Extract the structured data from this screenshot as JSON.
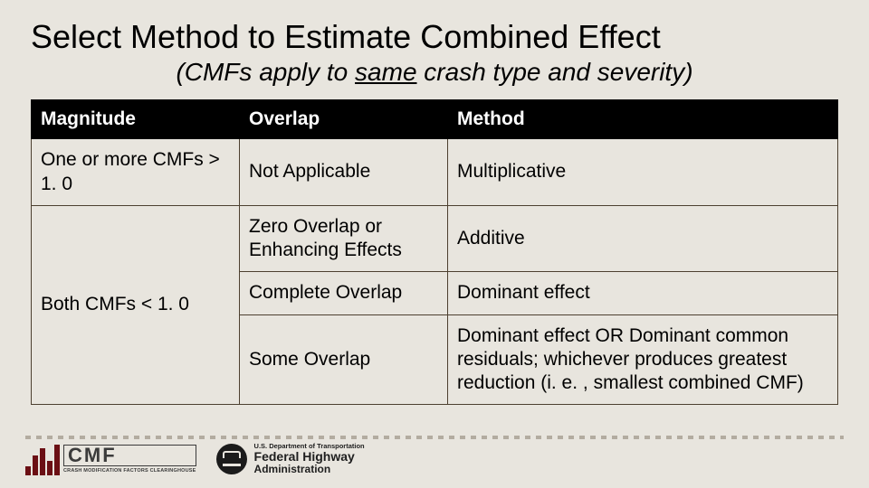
{
  "title": "Select Method to Estimate Combined Effect",
  "subtitle_prefix": "(CMFs apply to ",
  "subtitle_underlined": "same",
  "subtitle_suffix": " crash type and severity)",
  "table": {
    "headers": {
      "magnitude": "Magnitude",
      "overlap": "Overlap",
      "method": "Method"
    },
    "rows": [
      {
        "magnitude": "One or more CMFs > 1. 0",
        "overlap": "Not Applicable",
        "method": "Multiplicative"
      },
      {
        "magnitude": "Both CMFs < 1. 0",
        "overlap": "Zero Overlap or Enhancing Effects",
        "method": "Additive"
      },
      {
        "overlap": "Complete Overlap",
        "method": "Dominant effect"
      },
      {
        "overlap": "Some Overlap",
        "method": "Dominant effect OR Dominant common residuals; whichever produces greatest reduction (i. e. , smallest combined CMF)"
      }
    ]
  },
  "logos": {
    "cmf": {
      "letters": "CMF",
      "caption": "CRASH MODIFICATION FACTORS CLEARINGHOUSE"
    },
    "fhwa": {
      "line1": "U.S. Department of Transportation",
      "line2": "Federal Highway",
      "line3": "Administration"
    }
  }
}
